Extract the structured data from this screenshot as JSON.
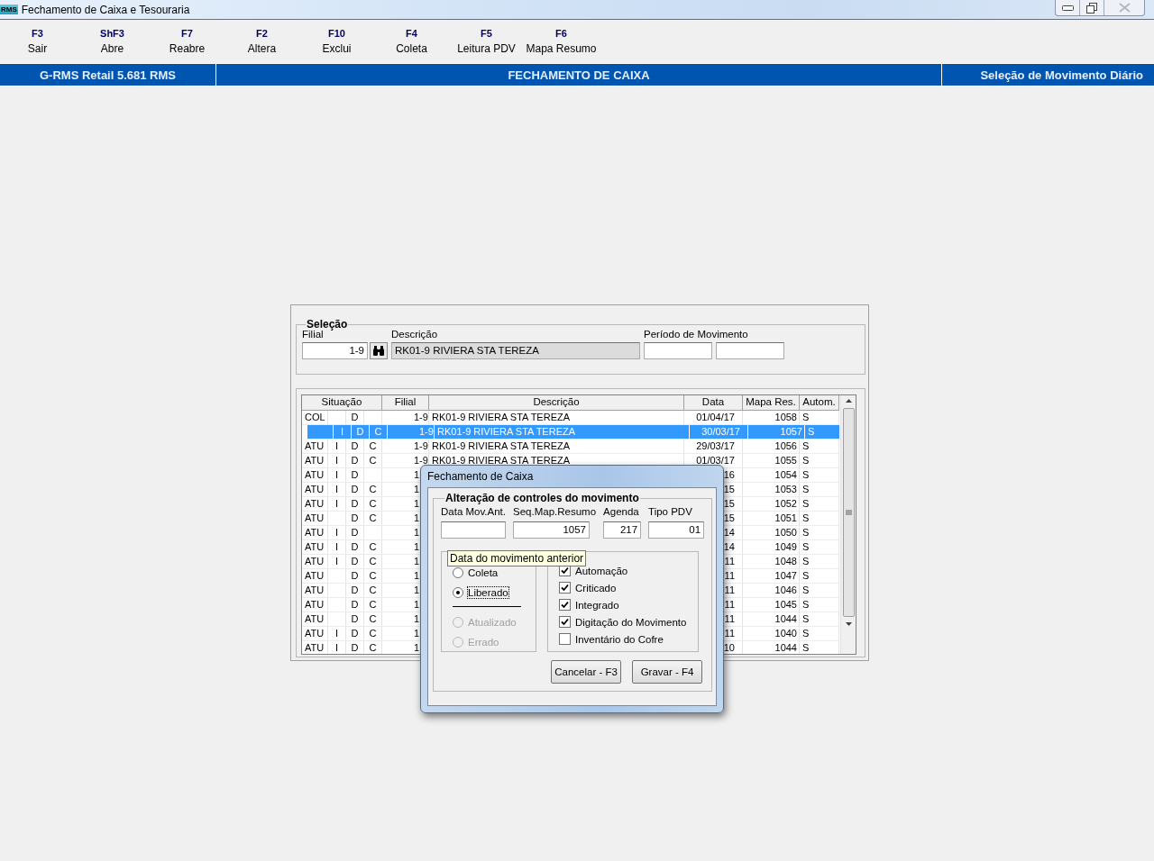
{
  "window": {
    "app_icon": "RMS",
    "title": "Fechamento de Caixa e Tesouraria"
  },
  "toolbar": [
    {
      "key": "F3",
      "label": "Sair"
    },
    {
      "key": "ShF3",
      "label": "Abre"
    },
    {
      "key": "F7",
      "label": "Reabre"
    },
    {
      "key": "F2",
      "label": "Altera"
    },
    {
      "key": "F10",
      "label": "Exclui"
    },
    {
      "key": "F4",
      "label": "Coleta"
    },
    {
      "key": "F5",
      "label": "Leitura PDV"
    },
    {
      "key": "F6",
      "label": "Mapa Resumo"
    }
  ],
  "header_bar": {
    "app": "G-RMS Retail 5.681 RMS",
    "module": "FECHAMENTO DE CAIXA",
    "screen": "Seleção de Movimento Diário"
  },
  "selection": {
    "title": "Seleção",
    "filial_label": "Filial",
    "filial": "1-9",
    "descricao_label": "Descrição",
    "descricao": "RK01-9 RIVIERA STA TEREZA",
    "periodo_label": "Período de Movimento"
  },
  "table": {
    "columns": [
      "Situação",
      "Filial",
      "Descrição",
      "Data",
      "Mapa Res.",
      "Autom."
    ],
    "rows": [
      {
        "selected": false,
        "situacao": "COL",
        "d": "D",
        "filial": "1-9",
        "descricao": "RK01-9 RIVIERA STA TEREZA",
        "data": "01/04/17",
        "mapa_res": "1058",
        "autom": "S"
      },
      {
        "selected": true,
        "i": "I",
        "d": "D",
        "c": "C",
        "filial": "1-9",
        "descricao": "RK01-9 RIVIERA STA TEREZA",
        "data": "30/03/17",
        "mapa_res": "1057",
        "autom": "S"
      },
      {
        "selected": false,
        "situacao": "ATU",
        "i": "I",
        "d": "D",
        "c": "C",
        "filial": "1-9",
        "descricao": "RK01-9 RIVIERA STA TEREZA",
        "data": "29/03/17",
        "mapa_res": "1056",
        "autom": "S"
      },
      {
        "selected": false,
        "situacao": "ATU",
        "i": "I",
        "d": "D",
        "c": "C",
        "filial": "1-9",
        "descricao": "RK01-9 RIVIERA STA TEREZA",
        "data": "01/03/17",
        "mapa_res": "1055",
        "autom": "S"
      },
      {
        "selected": false,
        "situacao": "ATU",
        "i": "I",
        "d": "D",
        "filial": "1",
        "data": "16",
        "mapa_res": "1054",
        "autom": "S"
      },
      {
        "selected": false,
        "situacao": "ATU",
        "i": "I",
        "d": "D",
        "c": "C",
        "filial": "1",
        "data": "15",
        "mapa_res": "1053",
        "autom": "S"
      },
      {
        "selected": false,
        "situacao": "ATU",
        "i": "I",
        "d": "D",
        "c": "C",
        "filial": "1",
        "data": "15",
        "mapa_res": "1052",
        "autom": "S"
      },
      {
        "selected": false,
        "situacao": "ATU",
        "d": "D",
        "c": "C",
        "filial": "1",
        "data": "15",
        "mapa_res": "1051",
        "autom": "S"
      },
      {
        "selected": false,
        "situacao": "ATU",
        "i": "I",
        "d": "D",
        "filial": "1",
        "data": "14",
        "mapa_res": "1050",
        "autom": "S"
      },
      {
        "selected": false,
        "situacao": "ATU",
        "i": "I",
        "d": "D",
        "c": "C",
        "filial": "1",
        "data": "14",
        "mapa_res": "1049",
        "autom": "S"
      },
      {
        "selected": false,
        "situacao": "ATU",
        "i": "I",
        "d": "D",
        "c": "C",
        "filial": "1",
        "data": "11",
        "mapa_res": "1048",
        "autom": "S"
      },
      {
        "selected": false,
        "situacao": "ATU",
        "d": "D",
        "c": "C",
        "filial": "1",
        "data": "11",
        "mapa_res": "1047",
        "autom": "S"
      },
      {
        "selected": false,
        "situacao": "ATU",
        "d": "D",
        "c": "C",
        "filial": "1",
        "data": "11",
        "mapa_res": "1046",
        "autom": "S"
      },
      {
        "selected": false,
        "situacao": "ATU",
        "d": "D",
        "c": "C",
        "filial": "1",
        "data": "11",
        "mapa_res": "1045",
        "autom": "S"
      },
      {
        "selected": false,
        "situacao": "ATU",
        "d": "D",
        "c": "C",
        "filial": "1",
        "data": "11",
        "mapa_res": "1044",
        "autom": "S"
      },
      {
        "selected": false,
        "situacao": "ATU",
        "i": "I",
        "d": "D",
        "c": "C",
        "filial": "1",
        "data": "11",
        "mapa_res": "1040",
        "autom": "S"
      },
      {
        "selected": false,
        "situacao": "ATU",
        "i": "I",
        "d": "D",
        "c": "C",
        "filial": "1",
        "data": "10",
        "mapa_res": "1044",
        "autom": "S"
      }
    ]
  },
  "dialog": {
    "title": "Fechamento de Caixa",
    "group_title": "Alteração de controles do movimento",
    "fields": [
      {
        "label": "Data Mov.Ant."
      },
      {
        "label": "Seq.Map.Resumo",
        "value": "1057"
      },
      {
        "label": "Agenda",
        "value": "217"
      },
      {
        "label": "Tipo PDV",
        "value": "01"
      }
    ],
    "tooltip": "Data do movimento anterior",
    "radios": [
      {
        "label": "Coleta",
        "selected": false,
        "disabled": false,
        "focused": false
      },
      {
        "label": "Liberado",
        "selected": true,
        "disabled": false,
        "focused": true
      },
      {
        "label": "Atualizado",
        "selected": false,
        "disabled": true,
        "focused": false
      },
      {
        "label": "Errado",
        "selected": false,
        "disabled": true,
        "focused": false
      }
    ],
    "checkboxes": [
      {
        "label": "Automação",
        "checked": true
      },
      {
        "label": "Criticado",
        "checked": true
      },
      {
        "label": "Integrado",
        "checked": true
      },
      {
        "label": "Digitação do Movimento",
        "checked": true
      },
      {
        "label": "Inventário do Cofre",
        "checked": false
      }
    ],
    "buttons": [
      "Cancelar - F3",
      "Gravar - F4"
    ]
  }
}
